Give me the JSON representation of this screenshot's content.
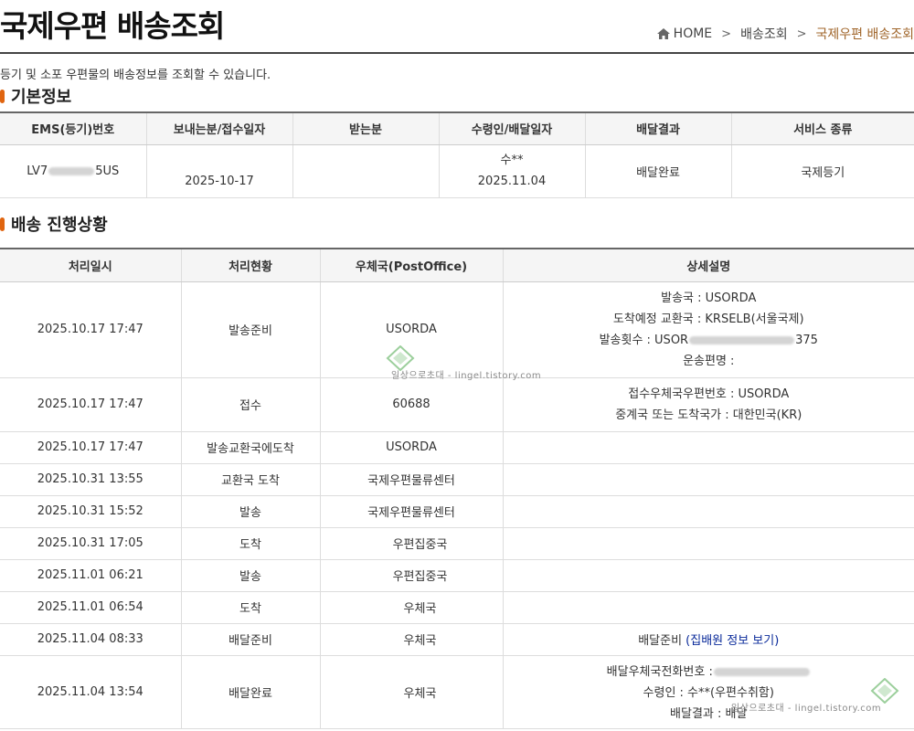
{
  "page": {
    "title": "국제우편 배송조회",
    "description": "등기 및 소포 우편물의 배송정보를 조회할 수 있습니다."
  },
  "breadcrumb": {
    "home": "HOME",
    "level1": "배송조회",
    "current": "국제우편 배송조회"
  },
  "basic_info": {
    "heading": "기본정보",
    "headers": [
      "EMS(등기)번호",
      "보내는분/접수일자",
      "받는분",
      "수령인/배달일자",
      "배달결과",
      "서비스 종류"
    ],
    "tracking_prefix": "LV7",
    "tracking_suffix": "5US",
    "send_date": "2025-10-17",
    "receiver": "",
    "recipient_name": "수**",
    "delivery_date": "2025.11.04",
    "result": "배달완료",
    "service": "국제등기"
  },
  "progress": {
    "heading": "배송 진행상황",
    "headers": [
      "처리일시",
      "처리현황",
      "우체국(PostOffice)",
      "상세설명"
    ],
    "rows": [
      {
        "time": "2025.10.17 17:47",
        "status": "발송준비",
        "office": "USORDA",
        "details": [
          "발송국 : USORDA",
          "도착예정 교환국 : KRSELB(서울국제)",
          "발송횟수 : USOR",
          "운송편명 :"
        ],
        "detail_suffix": "375"
      },
      {
        "time": "2025.10.17 17:47",
        "status": "접수",
        "office": "60688",
        "details": [
          "접수우체국우편번호 : USORDA",
          "중계국 또는 도착국가 : 대한민국(KR)"
        ]
      },
      {
        "time": "2025.10.17 17:47",
        "status": "발송교환국에도착",
        "office": "USORDA",
        "details": []
      },
      {
        "time": "2025.10.31 13:55",
        "status": "교환국 도착",
        "office": "국제우편물류센터",
        "details": []
      },
      {
        "time": "2025.10.31 15:52",
        "status": "발송",
        "office": "국제우편물류센터",
        "details": []
      },
      {
        "time": "2025.10.31 17:05",
        "status": "도착",
        "office": "우편집중국",
        "details": []
      },
      {
        "time": "2025.11.01 06:21",
        "status": "발송",
        "office": "우편집중국",
        "details": []
      },
      {
        "time": "2025.11.01 06:54",
        "status": "도착",
        "office": "우체국",
        "details": []
      },
      {
        "time": "2025.11.04 08:33",
        "status": "배달준비",
        "office": "우체국",
        "details": [
          "배달준비"
        ],
        "link": "(집배원 정보 보기)"
      },
      {
        "time": "2025.11.04 13:54",
        "status": "배달완료",
        "office": "우체국",
        "details": [
          "배달우체국전화번호 :",
          "수령인 : 수**(우편수취함)",
          "배달결과 : 배달"
        ]
      }
    ]
  },
  "watermark": {
    "text": "일상으로초대 - lingel.tistory.com"
  },
  "colors": {
    "accent": "#e06510",
    "breadcrumb_current": "#a0652a",
    "link": "#0a2a9a"
  }
}
